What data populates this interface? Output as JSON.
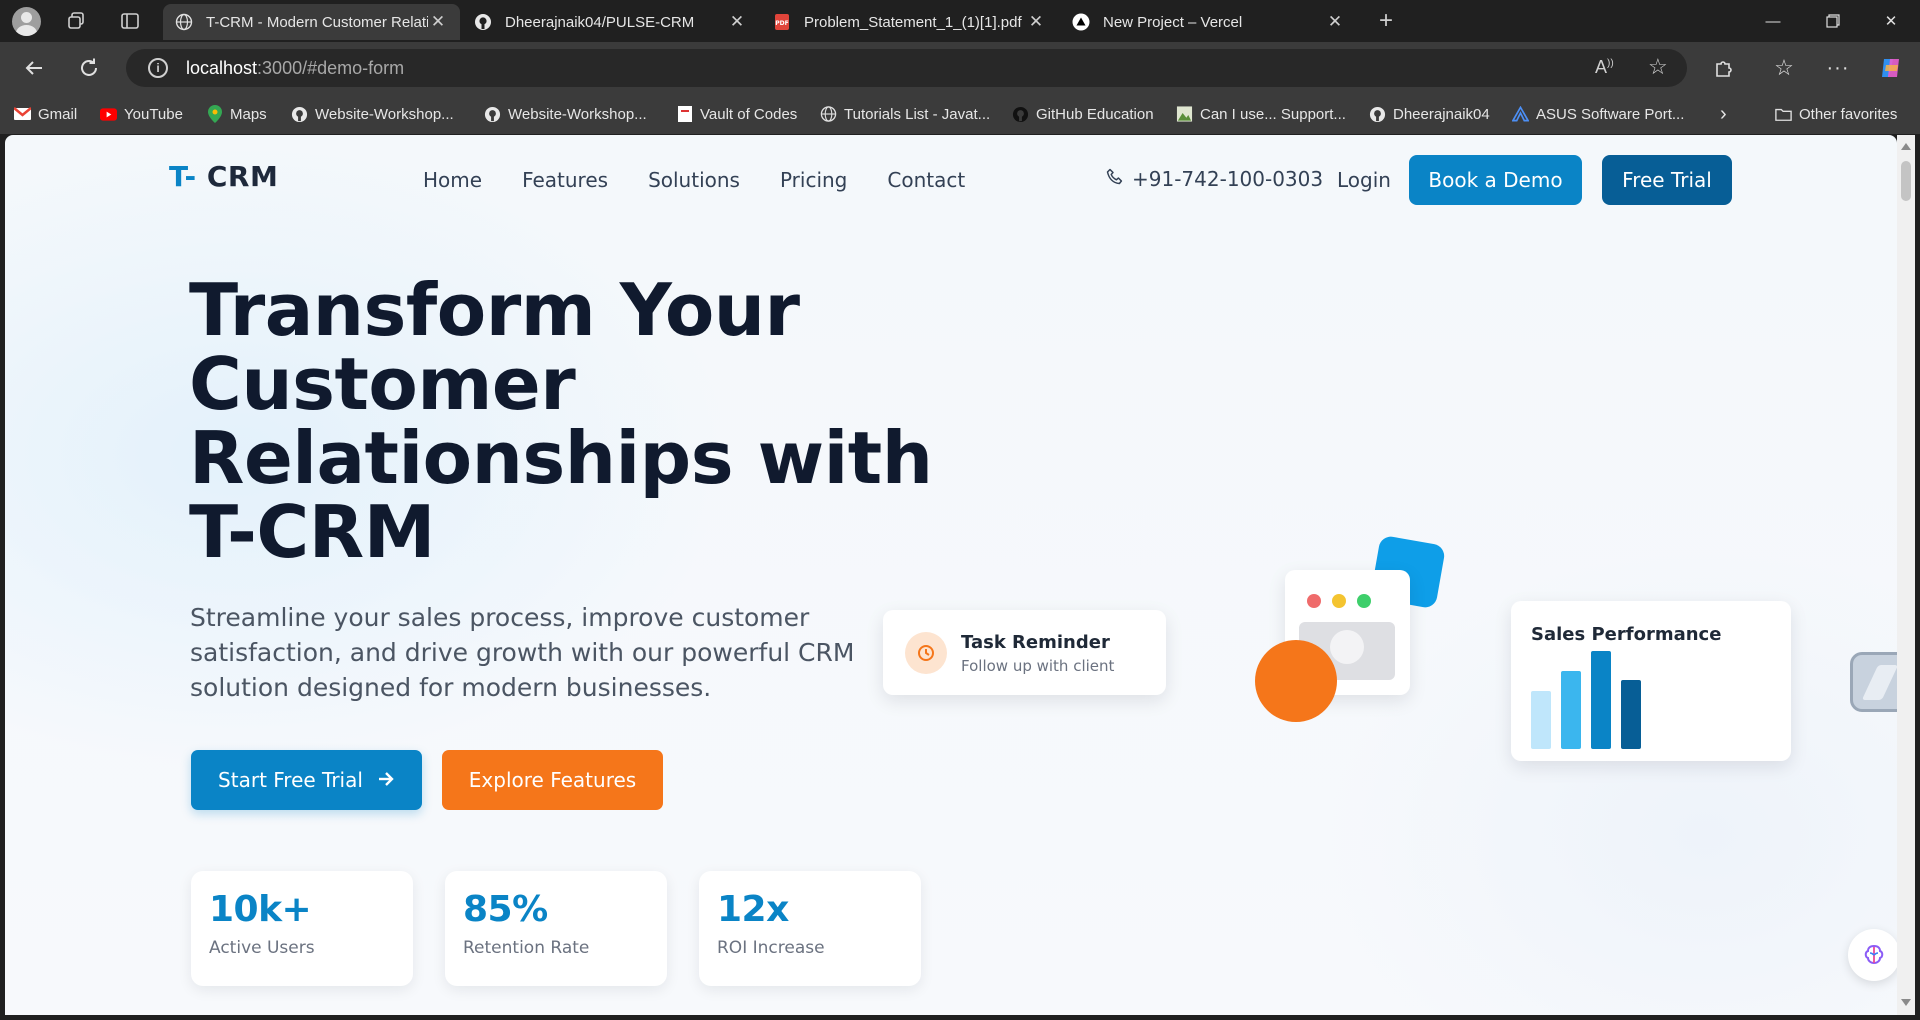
{
  "browser": {
    "tabs": [
      {
        "title": "T-CRM - Modern Customer Relati",
        "icon": "globe-icon",
        "active": true
      },
      {
        "title": "Dheerajnaik04/PULSE-CRM",
        "icon": "github-icon",
        "active": false
      },
      {
        "title": "Problem_Statement_1_(1)[1].pdf",
        "icon": "pdf-icon",
        "active": false
      },
      {
        "title": "New Project – Vercel",
        "icon": "vercel-icon",
        "active": false
      }
    ],
    "url_host": "localhost",
    "url_path": ":3000/#demo-form",
    "bookmarks": [
      {
        "label": "Gmail",
        "icon": "gmail-icon"
      },
      {
        "label": "YouTube",
        "icon": "youtube-icon"
      },
      {
        "label": "Maps",
        "icon": "maps-icon"
      },
      {
        "label": "Website-Workshop...",
        "icon": "github-icon"
      },
      {
        "label": "Website-Workshop...",
        "icon": "github-icon"
      },
      {
        "label": "Vault of Codes",
        "icon": "page-icon"
      },
      {
        "label": "Tutorials List - Javat...",
        "icon": "globe-icon"
      },
      {
        "label": "GitHub Education",
        "icon": "github-icon"
      },
      {
        "label": "Can I use... Support...",
        "icon": "image-icon"
      },
      {
        "label": "Dheerajnaik04",
        "icon": "github-icon"
      },
      {
        "label": "ASUS Software Port...",
        "icon": "asus-icon"
      }
    ],
    "other_favorites": "Other favorites"
  },
  "site": {
    "logo_accent": "T-",
    "logo_text": " CRM",
    "nav": [
      "Home",
      "Features",
      "Solutions",
      "Pricing",
      "Contact"
    ],
    "phone": "+91-742-100-0303",
    "login": "Login",
    "book_demo": "Book a Demo",
    "free_trial": "Free Trial"
  },
  "hero": {
    "title_lines": [
      "Transform Your",
      "Customer",
      "Relationships with",
      "T-CRM"
    ],
    "subtitle": "Streamline your sales process, improve customer satisfaction, and drive growth with our powerful CRM solution designed for modern businesses.",
    "start_trial": "Start Free Trial",
    "explore": "Explore Features"
  },
  "stats": [
    {
      "value": "10k+",
      "label": "Active Users"
    },
    {
      "value": "85%",
      "label": "Retention Rate"
    },
    {
      "value": "12x",
      "label": "ROI Increase"
    }
  ],
  "task_card": {
    "title": "Task Reminder",
    "subtitle": "Follow up with client"
  },
  "sales_card": {
    "title": "Sales Performance",
    "bar_levels": [
      0.58,
      0.78,
      0.98,
      0.69
    ],
    "bar_colors": [
      "#bfe6fb",
      "#3bb6ee",
      "#0a84c6",
      "#075e96"
    ]
  },
  "colors": {
    "primary": "#0a84c6",
    "primary_dark": "#075e96",
    "accent_orange": "#f5761a",
    "heading": "#101a2e"
  }
}
